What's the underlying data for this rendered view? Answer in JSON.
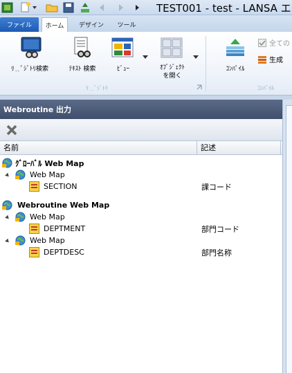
{
  "window": {
    "title": "TEST001 - test - LANSA エ"
  },
  "tabs": {
    "file": "ファイル",
    "home": "ホーム",
    "design": "デザイン",
    "tools": "ツール"
  },
  "ribbon": {
    "repository_search": "ﾘ﹎ﾟｼﾞﾄﾘ検索",
    "text_search": "ﾃｷｽﾄ 検索",
    "view": "ﾋﾞｭｰ",
    "open_object": "ｵﾌﾞｼﾞｪｸﾄを開く",
    "open_object_line1": "ｵﾌﾞｼﾞｪｸﾄ",
    "open_object_line2": "を開く",
    "compile": "ｺﾝﾊﾟｲﾙ",
    "all": "全ての",
    "generate": "生成",
    "group_repository": "ﾘ﹎ﾟｼﾞﾄﾘ",
    "group_compile": "ｺﾝﾊﾟｲﾙ"
  },
  "panel": {
    "title": "Webroutine 出力",
    "col_name": "名前",
    "col_desc": "記述"
  },
  "tree": [
    {
      "name": "ｸﾞﾛｰﾊﾞﾙ Web Map",
      "desc": "",
      "bold": true
    },
    {
      "name": "Web Map",
      "desc": "",
      "bold": false
    },
    {
      "name": "SECTION",
      "desc": "課コード",
      "bold": false
    },
    {
      "name": "Webroutine Web Map",
      "desc": "",
      "bold": true
    },
    {
      "name": "Web Map",
      "desc": "",
      "bold": false
    },
    {
      "name": "DEPTMENT",
      "desc": "部門コード",
      "bold": false
    },
    {
      "name": "Web Map",
      "desc": "",
      "bold": false
    },
    {
      "name": "DEPTDESC",
      "desc": "部門名称",
      "bold": false
    }
  ]
}
